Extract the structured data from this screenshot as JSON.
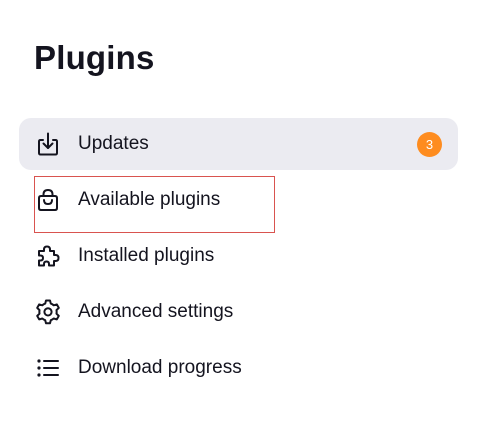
{
  "page": {
    "title": "Plugins"
  },
  "nav": {
    "items": [
      {
        "label": "Updates",
        "icon": "download-icon",
        "badge": "3",
        "active": true
      },
      {
        "label": "Available plugins",
        "icon": "shopping-bag-icon",
        "active": false,
        "highlighted": true
      },
      {
        "label": "Installed plugins",
        "icon": "puzzle-piece-icon",
        "active": false
      },
      {
        "label": "Advanced settings",
        "icon": "gear-icon",
        "active": false
      },
      {
        "label": "Download progress",
        "icon": "list-icon",
        "active": false
      }
    ]
  },
  "colors": {
    "text": "#14141f",
    "active_background": "#ebebf1",
    "badge": "#fe8c1f",
    "highlight_border": "#d9534f"
  }
}
